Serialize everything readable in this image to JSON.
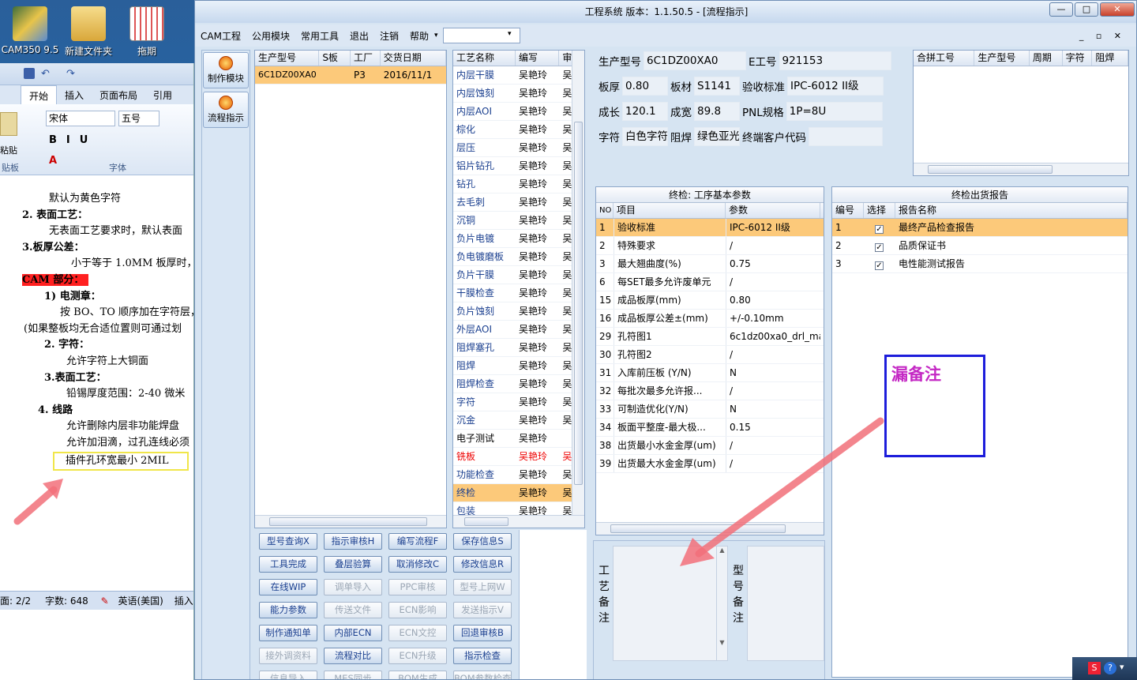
{
  "desktop": {
    "icons": [
      {
        "label": "CAM350 9.5"
      },
      {
        "label": "新建文件夹"
      },
      {
        "label": "拖期"
      }
    ]
  },
  "word": {
    "tabs": [
      "开始",
      "插入",
      "页面布局",
      "引用"
    ],
    "font_name": "宋体",
    "font_size": "五号",
    "clipboard_label": "粘贴",
    "group_clipboard": "贴板",
    "group_font": "字体",
    "doc_lines": [
      "默认为黄色字符",
      "2.   表面工艺：",
      "无表面工艺要求时，默认表面",
      "3.板厚公差：",
      "小于等于 1.0MM 板厚时，",
      "CAM 部分：",
      "1)   电测章：",
      "按 BO、TO 顺序加在字符层，",
      "(如果整板均无合适位置则可通过划",
      "2.   字符：",
      "允许字符上大铜面",
      "3.表面工艺：",
      "铅锡厚度范围：2-40 微米",
      "4.    线路",
      "允许删除内层非功能焊盘",
      "允许加泪滴，过孔连线必须",
      "插件孔环宽最小 2MIL"
    ],
    "status": {
      "page": "面: 2/2",
      "words": "字数: 648",
      "lang": "英语(美国)",
      "insert": "插入"
    }
  },
  "app": {
    "title": "工程系统   版本：1.1.50.5 - [流程指示]",
    "menu": [
      "CAM工程",
      "公用模块",
      "常用工具",
      "退出",
      "注销",
      "帮助"
    ],
    "left_buttons": [
      "制作模块",
      "流程指示"
    ],
    "orders": {
      "headers": [
        "生产型号",
        "S板",
        "工厂",
        "交货日期"
      ],
      "rows": [
        [
          "6C1DZ00XA0",
          "",
          "P3",
          "2016/11/1"
        ]
      ]
    },
    "process": {
      "headers": [
        "工艺名称",
        "编写",
        "审"
      ],
      "rows": [
        [
          "内层干膜",
          "吴艳玲",
          "吴"
        ],
        [
          "内层蚀刻",
          "吴艳玲",
          "吴"
        ],
        [
          "内层AOI",
          "吴艳玲",
          "吴"
        ],
        [
          "棕化",
          "吴艳玲",
          "吴"
        ],
        [
          "层压",
          "吴艳玲",
          "吴"
        ],
        [
          "铝片钻孔",
          "吴艳玲",
          "吴"
        ],
        [
          "钻孔",
          "吴艳玲",
          "吴"
        ],
        [
          "去毛刺",
          "吴艳玲",
          "吴"
        ],
        [
          "沉铜",
          "吴艳玲",
          "吴"
        ],
        [
          "负片电镀",
          "吴艳玲",
          "吴"
        ],
        [
          "负电镀磨板",
          "吴艳玲",
          "吴"
        ],
        [
          "负片干膜",
          "吴艳玲",
          "吴"
        ],
        [
          "干膜检查",
          "吴艳玲",
          "吴"
        ],
        [
          "负片蚀刻",
          "吴艳玲",
          "吴"
        ],
        [
          "外层AOI",
          "吴艳玲",
          "吴"
        ],
        [
          "阻焊塞孔",
          "吴艳玲",
          "吴"
        ],
        [
          "阻焊",
          "吴艳玲",
          "吴"
        ],
        [
          "阻焊检查",
          "吴艳玲",
          "吴"
        ],
        [
          "字符",
          "吴艳玲",
          "吴"
        ],
        [
          "沉金",
          "吴艳玲",
          "吴"
        ],
        [
          "电子测试",
          "吴艳玲",
          ""
        ],
        [
          "铣板",
          "吴艳玲",
          "吴"
        ],
        [
          "功能检查",
          "吴艳玲",
          "吴"
        ],
        [
          "终检",
          "吴艳玲",
          "吴"
        ],
        [
          "包装",
          "吴艳玲",
          "吴"
        ]
      ]
    },
    "info": {
      "l_model": "生产型号",
      "v_model": "6C1DZ00XA0",
      "l_eno": "E工号",
      "v_eno": "921153",
      "l_thick": "板厚",
      "v_thick": "0.80",
      "l_mat": "板材",
      "v_mat": "S1141",
      "l_std": "验收标准",
      "v_std": "IPC-6012 II级",
      "l_len": "成长",
      "v_len": "120.1",
      "l_wid": "成宽",
      "v_wid": "89.8",
      "l_pnl": "PNL规格",
      "v_pnl": "1P=8U",
      "l_silk": "字符",
      "v_silk": "白色字符",
      "l_mask": "阻焊",
      "v_mask": "绿色亚光",
      "l_cust": "终端客户代码",
      "v_cust": ""
    },
    "merge": {
      "headers": [
        "合拼工号",
        "生产型号",
        "周期",
        "字符",
        "阻焊"
      ]
    },
    "params": {
      "title": "终检: 工序基本参数",
      "headers": [
        "NO",
        "项目",
        "参数"
      ],
      "rows": [
        [
          "1",
          "验收标准",
          "IPC-6012 II级"
        ],
        [
          "2",
          "特殊要求",
          "/"
        ],
        [
          "3",
          "最大翘曲度(%)",
          "0.75"
        ],
        [
          "6",
          "每SET最多允许废单元",
          "/"
        ],
        [
          "15",
          "成品板厚(mm)",
          "0.80"
        ],
        [
          "16",
          "成品板厚公差±(mm)",
          "+/-0.10mm"
        ],
        [
          "29",
          "孔符图1",
          "6c1dz00xa0_drl_ma"
        ],
        [
          "30",
          "孔符图2",
          "/"
        ],
        [
          "31",
          "入库前压板 (Y/N)",
          "N"
        ],
        [
          "32",
          "每批次最多允许报...",
          "/"
        ],
        [
          "33",
          "可制造优化(Y/N)",
          "N"
        ],
        [
          "34",
          "板面平整度-最大极...",
          "0.15"
        ],
        [
          "38",
          "出货最小水金金厚(um)",
          "/"
        ],
        [
          "39",
          "出货最大水金金厚(um)",
          "/"
        ]
      ]
    },
    "reports": {
      "title": "终检出货报告",
      "headers": [
        "编号",
        "选择",
        "报告名称"
      ],
      "rows": [
        [
          "1",
          "✓",
          "最终产品检查报告"
        ],
        [
          "2",
          "✓",
          "品质保证书"
        ],
        [
          "3",
          "✓",
          "电性能测试报告"
        ]
      ]
    },
    "buttons": [
      [
        "型号查询X",
        "指示审核H",
        "编写流程F",
        "保存信息S"
      ],
      [
        "工具完成",
        "叠层验算",
        "取消修改C",
        "修改信息R"
      ],
      [
        "在线WIP",
        "调单导入",
        "PPC审核",
        "型号上网W"
      ],
      [
        "能力参数",
        "传送文件",
        "ECN影响",
        "发送指示V"
      ],
      [
        "制作通知单",
        "内部ECN",
        "ECN文控",
        "回退审核B"
      ],
      [
        "接外调资料",
        "流程对比",
        "ECN升级",
        "指示检查"
      ],
      [
        "信息导入",
        "MES同步",
        "BOM生成",
        "BOM参数检查"
      ]
    ],
    "label_proc_remark": "工艺备注",
    "label_model_remark": "型号备注",
    "annotation": "漏备注"
  },
  "colors": {
    "selection": "#fcc97a",
    "annotation_text": "#c428c4",
    "annotation_border": "#1d1ddb",
    "arrow": "#f2707a",
    "highlight": "#ff2020"
  }
}
